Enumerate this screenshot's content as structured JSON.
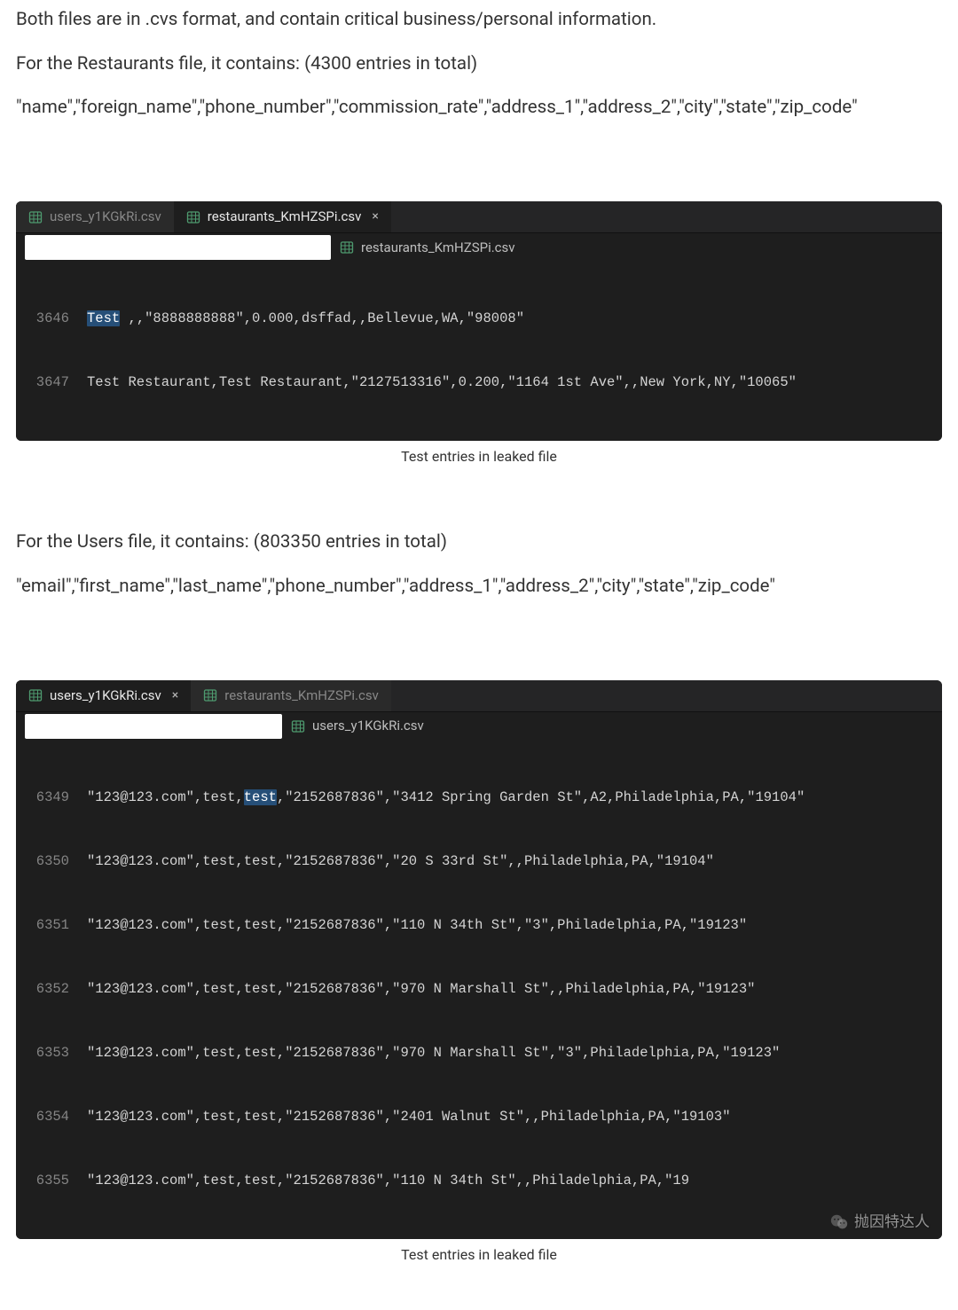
{
  "paragraphs": {
    "intro": "Both files are in .cvs format, and contain critical business/personal information.",
    "restaurants_header": "For the Restaurants file, it contains: (4300 entries in total)",
    "restaurants_fields": "\"name\",\"foreign_name\",\"phone_number\",\"commission_rate\",\"address_1\",\"address_2\",\"city\",\"state\",\"zip_code\"",
    "users_header": "For the Users file, it contains: (803350 entries in total)",
    "users_fields": "\"email\",\"first_name\",\"last_name\",\"phone_number\",\"address_1\",\"address_2\",\"city\",\"state\",\"zip_code\""
  },
  "editor1": {
    "tabs": {
      "left": {
        "label": "users_y1KGkRi.csv",
        "active": false
      },
      "right": {
        "label": "restaurants_KmHZSPi.csv",
        "active": true,
        "close": "×"
      }
    },
    "path_label": "restaurants_KmHZSPi.csv",
    "rows": [
      {
        "ln": "3646",
        "pre": "",
        "hl": "Test",
        "post": " ,,\"8888888888\",0.000,dsffad,,Bellevue,WA,\"98008\""
      },
      {
        "ln": "3647",
        "pre": "Test Restaurant,Test Restaurant,\"2127513316\",0.200,\"1164 1st Ave\",,New York,NY,\"10065\"",
        "hl": "",
        "post": ""
      }
    ],
    "caption": "Test entries in leaked file"
  },
  "editor2": {
    "tabs": {
      "left": {
        "label": "users_y1KGkRi.csv",
        "active": true,
        "close": "×"
      },
      "right": {
        "label": "restaurants_KmHZSPi.csv",
        "active": false
      }
    },
    "path_label": "users_y1KGkRi.csv",
    "rows": [
      {
        "ln": "6349",
        "pre": "\"123@123.com\",test,",
        "hl": "test",
        "post": ",\"2152687836\",\"3412 Spring Garden St\",A2,Philadelphia,PA,\"19104\""
      },
      {
        "ln": "6350",
        "pre": "\"123@123.com\",test,test,\"2152687836\",\"20 S 33rd St\",,Philadelphia,PA,\"19104\"",
        "hl": "",
        "post": ""
      },
      {
        "ln": "6351",
        "pre": "\"123@123.com\",test,test,\"2152687836\",\"110 N 34th St\",\"3\",Philadelphia,PA,\"19123\"",
        "hl": "",
        "post": ""
      },
      {
        "ln": "6352",
        "pre": "\"123@123.com\",test,test,\"2152687836\",\"970 N Marshall St\",,Philadelphia,PA,\"19123\"",
        "hl": "",
        "post": ""
      },
      {
        "ln": "6353",
        "pre": "\"123@123.com\",test,test,\"2152687836\",\"970 N Marshall St\",\"3\",Philadelphia,PA,\"19123\"",
        "hl": "",
        "post": ""
      },
      {
        "ln": "6354",
        "pre": "\"123@123.com\",test,test,\"2152687836\",\"2401 Walnut St\",,Philadelphia,PA,\"19103\"",
        "hl": "",
        "post": ""
      },
      {
        "ln": "6355",
        "pre": "\"123@123.com\",test,test,\"2152687836\",\"110 N 34th St\",,Philadelphia,PA,\"19",
        "hl": "",
        "post": ""
      }
    ],
    "caption": "Test entries in leaked file"
  },
  "watermark_text": "抛因特达人"
}
